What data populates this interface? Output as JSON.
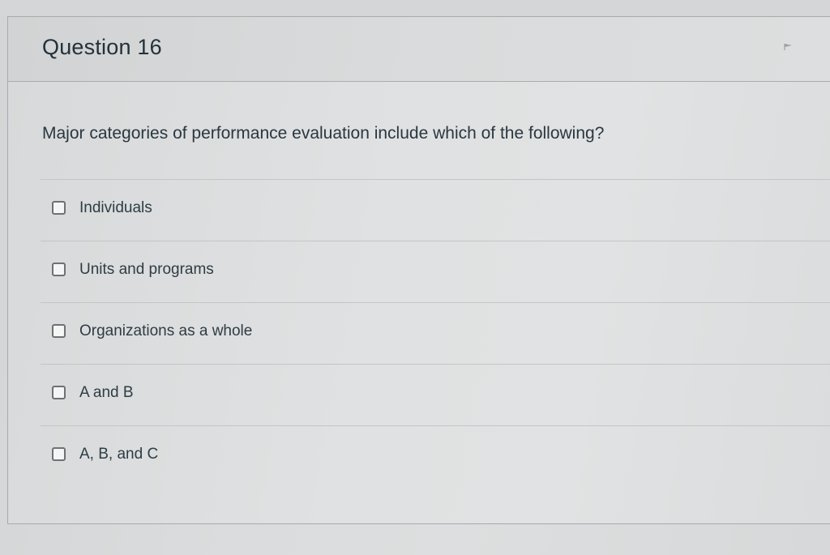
{
  "question": {
    "title": "Question 16",
    "text": "Major categories of performance evaluation include which of the following?",
    "answers": [
      {
        "label": "Individuals",
        "checked": false
      },
      {
        "label": "Units and programs",
        "checked": false
      },
      {
        "label": "Organizations as a whole",
        "checked": false
      },
      {
        "label": "A and B",
        "checked": false
      },
      {
        "label": "A, B, and C",
        "checked": false
      }
    ]
  },
  "icons": {
    "flag": "flag-icon"
  }
}
